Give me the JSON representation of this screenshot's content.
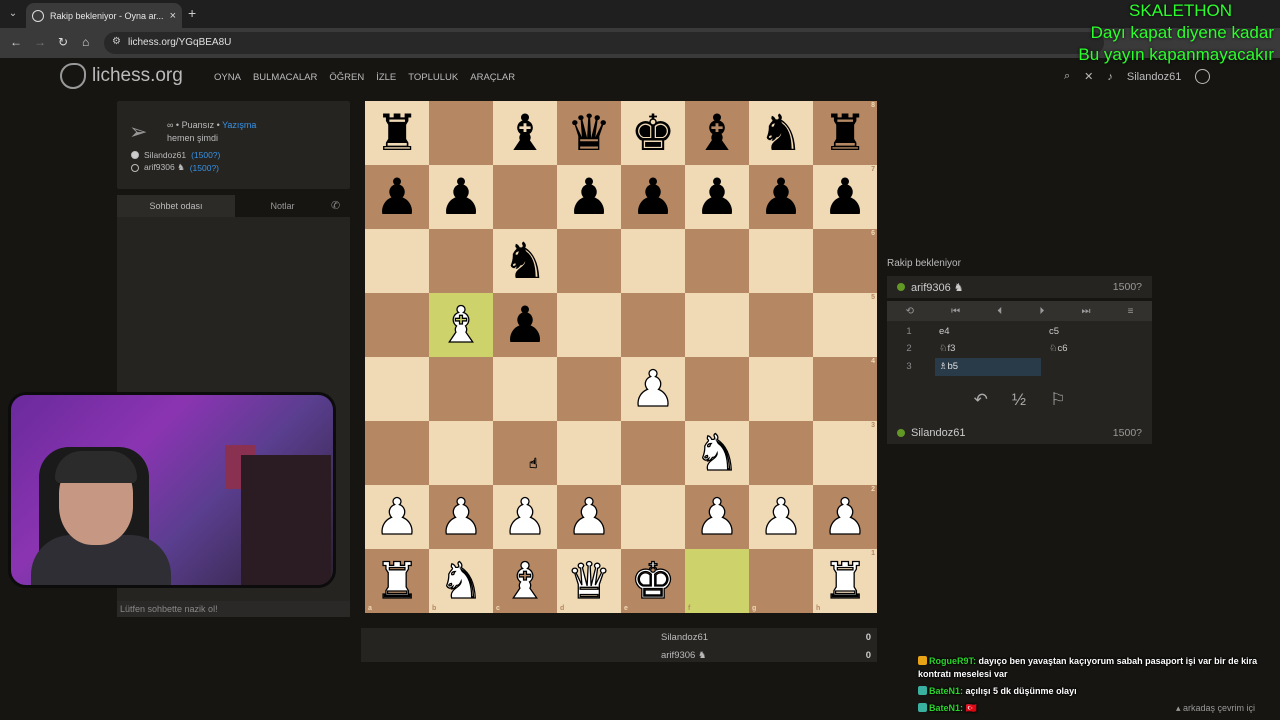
{
  "browser": {
    "tab_title": "Rakip bekleniyor - Oyna ar...",
    "url": "lichess.org/YGqBEA8U",
    "new_tab_icon": "+",
    "close_icon": "×"
  },
  "site": {
    "logo": "lichess.org",
    "nav": [
      "OYNA",
      "BULMACALAR",
      "ÖĞREN",
      "İZLE",
      "TOPLULUK",
      "ARAÇLAR"
    ],
    "username": "Silandoz61"
  },
  "game_info": {
    "mode_prefix": "∞ • Puansız •",
    "mode_link": "Yazışma",
    "time": "hemen şimdi",
    "players": [
      {
        "name": "Silandoz61",
        "rating": "(1500?)"
      },
      {
        "name": "arif9306 ♞",
        "rating": "(1500?)"
      }
    ]
  },
  "chat": {
    "tab_active": "Sohbet odası",
    "tab_notes": "Notlar",
    "placeholder": "Lütfen sohbette nazik ol!"
  },
  "board": {
    "files": [
      "a",
      "b",
      "c",
      "d",
      "e",
      "f",
      "g",
      "h"
    ],
    "ranks": [
      "8",
      "7",
      "6",
      "5",
      "4",
      "3",
      "2",
      "1"
    ],
    "position": [
      [
        "br",
        "",
        "bb",
        "bq",
        "bk",
        "bb",
        "bn",
        "br"
      ],
      [
        "bp",
        "bp",
        "",
        "bp",
        "bp",
        "bp",
        "bp",
        "bp"
      ],
      [
        "",
        "",
        "bn",
        "",
        "",
        "",
        "",
        ""
      ],
      [
        "",
        "wb",
        "bp",
        "",
        "",
        "",
        "",
        ""
      ],
      [
        "",
        "",
        "",
        "",
        "wp",
        "",
        "",
        ""
      ],
      [
        "",
        "",
        "",
        "",
        "",
        "wn",
        "",
        ""
      ],
      [
        "wp",
        "wp",
        "wp",
        "wp",
        "",
        "wp",
        "wp",
        "wp"
      ],
      [
        "wr",
        "wn",
        "wb",
        "wq",
        "wk",
        "",
        "",
        "wr"
      ]
    ],
    "highlight": [
      "b5",
      "f1"
    ]
  },
  "panel": {
    "status": "Rakip bekleniyor",
    "opponent": {
      "name": "arif9306 ♞",
      "rating": "1500?"
    },
    "me": {
      "name": "Silandoz61",
      "rating": "1500?"
    },
    "moves": [
      {
        "n": "1",
        "w": "e4",
        "b": "c5"
      },
      {
        "n": "2",
        "w": "♘f3",
        "b": "♘c6"
      },
      {
        "n": "3",
        "w": "♗b5",
        "b": ""
      }
    ],
    "controls": [
      "⟲",
      "⏮",
      "⏴",
      "⏵",
      "⏭",
      "≡"
    ],
    "actions": [
      "↶",
      "½",
      "⚐"
    ]
  },
  "scores": [
    {
      "name": "Silandoz61",
      "score": "0"
    },
    {
      "name": "arif9306 ♞",
      "score": "0"
    }
  ],
  "overlay": {
    "line1": "SKALETHON",
    "line2": "Dayı kapat diyene kadar",
    "line3": "Bu yayın kapanmayacakır"
  },
  "twitch_chat": [
    {
      "user": "RogueR9T:",
      "msg": "dayıço ben yavaştan kaçıyorum sabah pasaport işi var bir de kira kontratı meselesi var",
      "color": "#2bd52b"
    },
    {
      "user": "BateN1:",
      "msg": "açılışı 5 dk düşünme olayı",
      "color": "#2bd52b"
    },
    {
      "user": "BateN1:",
      "msg": "🇹🇷",
      "color": "#2bd52b"
    }
  ],
  "friends": "arkadaş çevrim içi",
  "colors": {
    "light": "#f0d9b5",
    "dark": "#b58863",
    "accent": "#3692e7",
    "online": "#629924"
  }
}
